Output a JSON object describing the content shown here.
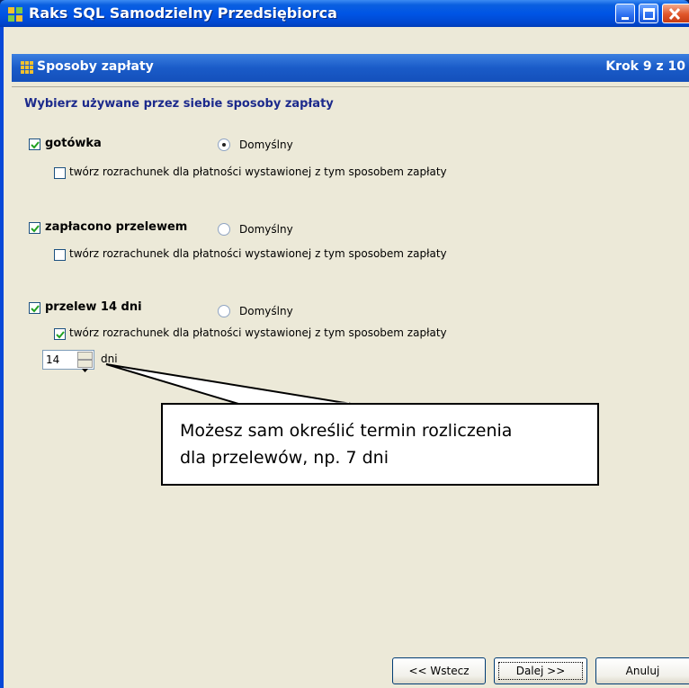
{
  "window": {
    "title": "Raks SQL Samodzielny Przedsiębiorca"
  },
  "wizard": {
    "title": "Sposoby zapłaty",
    "step": "Krok 9 z 10"
  },
  "content": {
    "heading": "Wybierz używane przez siebie sposoby zapłaty",
    "methods": [
      {
        "name": "gotówka",
        "enabled": true,
        "default_label": "Domyślny",
        "default_selected": true,
        "settlement_label": "twórz rozrachunek dla płatności wystawionej z tym sposobem zapłaty",
        "settlement_checked": false
      },
      {
        "name": "zapłacono przelewem",
        "enabled": true,
        "default_label": "Domyślny",
        "default_selected": false,
        "settlement_label": "twórz rozrachunek dla płatności wystawionej z tym sposobem zapłaty",
        "settlement_checked": false
      },
      {
        "name": "przelew 14 dni",
        "enabled": true,
        "default_label": "Domyślny",
        "default_selected": false,
        "settlement_label": "twórz rozrachunek dla płatności wystawionej z tym sposobem zapłaty",
        "settlement_checked": true,
        "days_value": "14",
        "days_unit": "dni"
      }
    ]
  },
  "callout": {
    "line1": "Możesz sam określić termin rozliczenia",
    "line2": "dla przelewów, np. 7 dni"
  },
  "buttons": {
    "back": "<< Wstecz",
    "next": "Dalej >>",
    "cancel": "Anuluj"
  },
  "colors": {
    "titlebar": "#0055e5",
    "wizard_header": "#1a5bc8",
    "heading_text": "#1c2a8c",
    "panel_bg": "#ece9d8"
  }
}
